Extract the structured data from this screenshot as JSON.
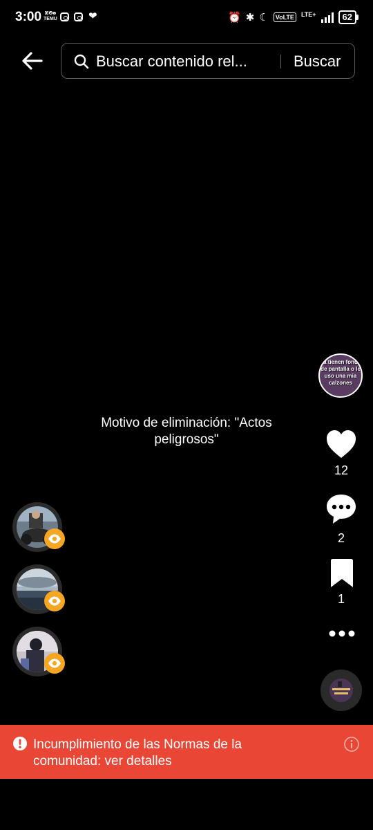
{
  "status_bar": {
    "time": "3:00",
    "temu_top": "ꕤꙨꙩ",
    "temu_bottom": "TEMU",
    "battery": "62",
    "volte": "VoLTE",
    "lte": "LTE+",
    "icons": [
      "instagram-icon",
      "instagram-icon",
      "heart-icon",
      "alarm-icon",
      "bluetooth-icon",
      "moon-icon",
      "volte-icon",
      "signal-icon",
      "battery-icon"
    ]
  },
  "header": {
    "search_value": "Buscar contenido rel...",
    "search_button": "Buscar"
  },
  "video": {
    "removal_reason": "Motivo de eliminación: \"Actos peligrosos\""
  },
  "creator": {
    "avatar_text": "Ya tienen fondo de pantalla o le uso una mia calzones"
  },
  "actions": {
    "likes": "12",
    "comments": "2",
    "saves": "1"
  },
  "viewers": [
    {
      "name": "viewer-1"
    },
    {
      "name": "viewer-2"
    },
    {
      "name": "viewer-3"
    }
  ],
  "banner": {
    "text": "Incumplimiento de las Normas de la comunidad: ver detalles",
    "color": "#e94635"
  },
  "colors": {
    "background": "#000000",
    "badge": "#f5a623"
  }
}
